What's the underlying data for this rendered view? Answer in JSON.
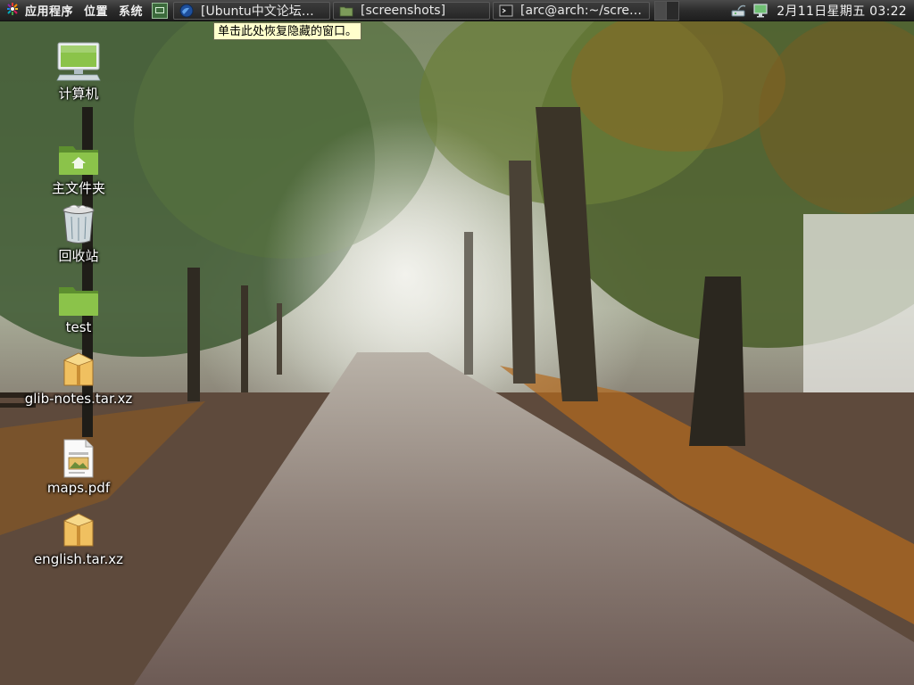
{
  "panel": {
    "menus": [
      {
        "label": "应用程序"
      },
      {
        "label": "位置"
      },
      {
        "label": "系统"
      }
    ],
    "tasks": [
      {
        "label": "[Ubuntu中文论坛…",
        "icon": "browser-globe-icon"
      },
      {
        "label": "[screenshots]",
        "icon": "folder-icon"
      },
      {
        "label": "[arc@arch:~/scre…",
        "icon": "terminal-icon"
      }
    ],
    "clock": "2月11日星期五 03:22"
  },
  "tooltip": {
    "text": "单击此处恢复隐藏的窗口。"
  },
  "desktop": {
    "icons": [
      {
        "label": "计算机",
        "icon": "computer-icon"
      },
      {
        "label": "主文件夹",
        "icon": "home-folder-icon"
      },
      {
        "label": "回收站",
        "icon": "trash-icon"
      },
      {
        "label": "test",
        "icon": "folder-icon"
      },
      {
        "label": "glib-notes.tar.xz",
        "icon": "archive-icon"
      },
      {
        "label": "maps.pdf",
        "icon": "pdf-document-icon"
      },
      {
        "label": "english.tar.xz",
        "icon": "archive-icon"
      }
    ]
  },
  "colors": {
    "panel_bg": "#2c2c2c",
    "tooltip_bg": "#ffffcc",
    "folder_green": "#7cb342"
  }
}
